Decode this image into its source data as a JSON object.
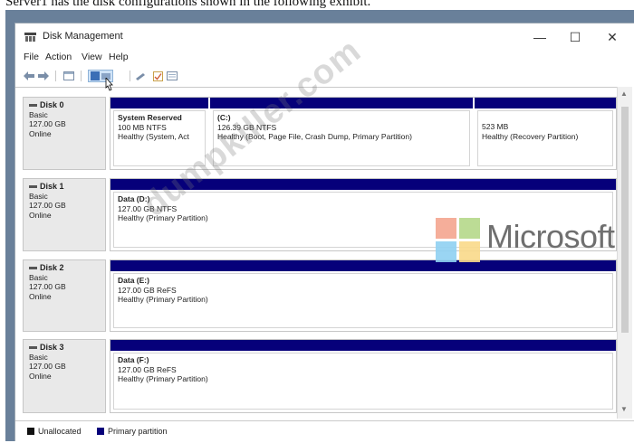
{
  "caption": "Server1 has the disk configurations shown in the following exhibit.",
  "window": {
    "title": "Disk Management",
    "controls": {
      "minimize": "—",
      "maximize": "☐",
      "close": "✕"
    }
  },
  "menu": [
    "File",
    "Action",
    "View",
    "Help"
  ],
  "disks": [
    {
      "name": "Disk 0",
      "type": "Basic",
      "size": "127.00 GB",
      "status": "Online",
      "partitions": [
        {
          "label": "System Reserved",
          "detail": "100 MB NTFS",
          "health": "Healthy (System, Act"
        },
        {
          "label": "(C:)",
          "detail": "126.39 GB NTFS",
          "health": "Healthy (Boot, Page File, Crash Dump, Primary Partition)"
        },
        {
          "label": "",
          "detail": "523 MB",
          "health": "Healthy (Recovery Partition)"
        }
      ]
    },
    {
      "name": "Disk 1",
      "type": "Basic",
      "size": "127.00 GB",
      "status": "Online",
      "partitions": [
        {
          "label": "Data (D:)",
          "detail": "127.00 GB NTFS",
          "health": "Healthy (Primary Partition)"
        }
      ]
    },
    {
      "name": "Disk 2",
      "type": "Basic",
      "size": "127.00 GB",
      "status": "Online",
      "partitions": [
        {
          "label": "Data (E:)",
          "detail": "127.00 GB ReFS",
          "health": "Healthy (Primary Partition)"
        }
      ]
    },
    {
      "name": "Disk 3",
      "type": "Basic",
      "size": "127.00 GB",
      "status": "Online",
      "partitions": [
        {
          "label": "Data (F:)",
          "detail": "127.00 GB ReFS",
          "health": "Healthy (Primary Partition)"
        }
      ]
    }
  ],
  "legend": {
    "unallocated": {
      "label": "Unallocated",
      "color": "#111111"
    },
    "primary": {
      "label": "Primary partition",
      "color": "#06007a"
    }
  },
  "watermark": "dumpkiller.com",
  "brand": {
    "text": "Microsoft",
    "colors": [
      "#f25022",
      "#7fba00",
      "#00a4ef",
      "#ffb900"
    ]
  },
  "icons": {
    "app": "disk-management-icon",
    "toolbar": [
      "back-arrow-icon",
      "forward-arrow-icon",
      "console-tree-icon",
      "disk-list-icon",
      "help-icon",
      "properties-icon",
      "check-icon",
      "window-icon"
    ],
    "cursor": "mouse-pointer-icon"
  }
}
